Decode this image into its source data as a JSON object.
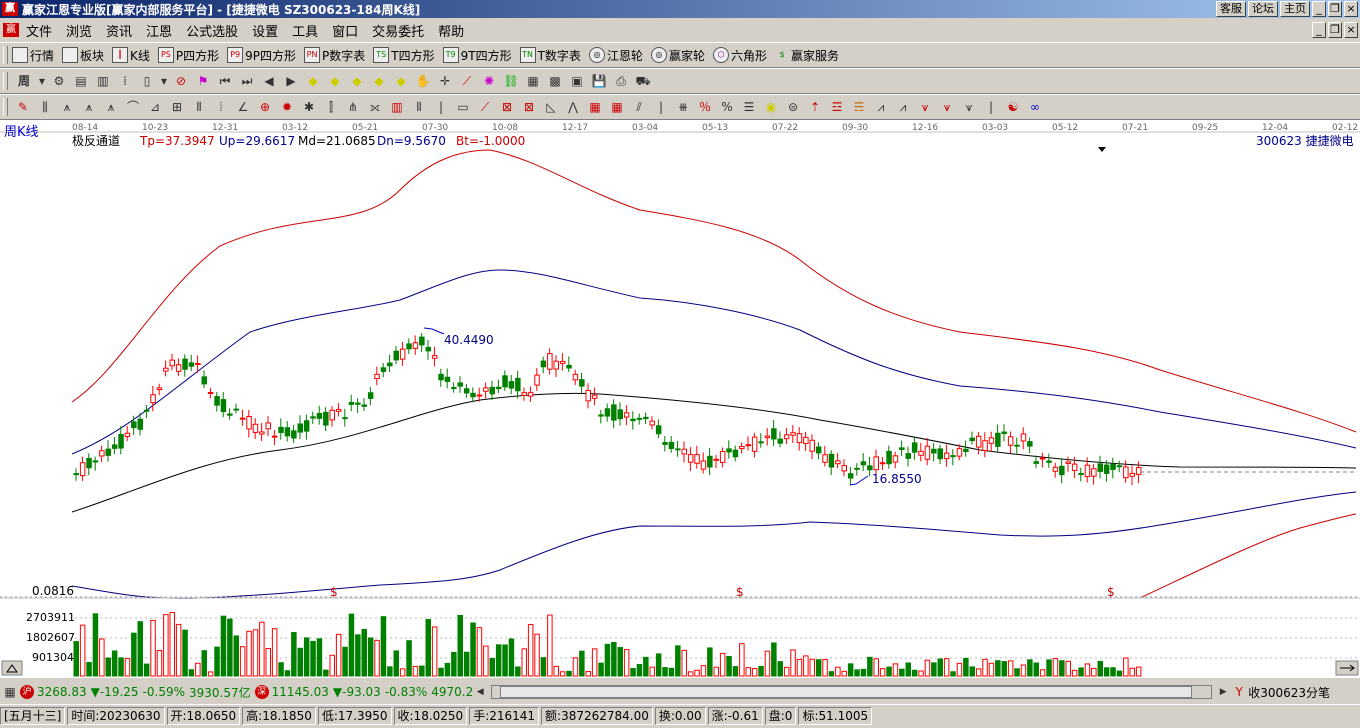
{
  "window": {
    "logo": "赢",
    "title": "赢家江恩专业版[赢家内部服务平台] - [捷捷微电   SZ300623-184周K线]",
    "buttons": [
      "客服",
      "论坛",
      "主页"
    ]
  },
  "menu": {
    "logo": "赢",
    "items": [
      "文件",
      "浏览",
      "资讯",
      "江恩",
      "公式选股",
      "设置",
      "工具",
      "窗口",
      "交易委托",
      "帮助"
    ]
  },
  "toolbar1": {
    "items": [
      {
        "label": "行情",
        "icon": "grid-icon",
        "mark": ""
      },
      {
        "label": "板块",
        "icon": "blocks-icon",
        "mark": ""
      },
      {
        "label": "K线",
        "icon": "candle-icon",
        "mark": ""
      },
      {
        "label": "P四方形",
        "icon": "square-icon",
        "mark": "PS"
      },
      {
        "label": "9P四方形",
        "icon": "square-icon",
        "mark": "P9"
      },
      {
        "label": "P数字表",
        "icon": "table-icon",
        "mark": "PN"
      },
      {
        "label": "T四方形",
        "icon": "square-icon",
        "mark": "TS"
      },
      {
        "label": "9T四方形",
        "icon": "square-icon",
        "mark": "T9"
      },
      {
        "label": "T数字表",
        "icon": "table-icon",
        "mark": "TN"
      },
      {
        "label": "江恩轮",
        "icon": "wheel-icon",
        "mark": ""
      },
      {
        "label": "赢家轮",
        "icon": "wheel-icon",
        "mark": ""
      },
      {
        "label": "六角形",
        "icon": "hexagon-icon",
        "mark": ""
      },
      {
        "label": "赢家服务",
        "icon": "dollar-icon",
        "mark": "$"
      }
    ]
  },
  "period": {
    "label": "周"
  },
  "chart": {
    "panel_title": "周K线",
    "indicator": {
      "name": "极反通道",
      "tp": "Tp=37.3947",
      "up": "Up=29.6617",
      "md": "Md=21.0685",
      "dn": "Dn=9.5670",
      "bt": "Bt=-1.0000"
    },
    "stock_label": "300623  捷捷微电",
    "date_axis": [
      "08-14",
      "10-23",
      "12-31",
      "03-12",
      "05-21",
      "07-30",
      "10-08",
      "12-17",
      "03-04",
      "05-13",
      "07-22",
      "09-30",
      "12-16",
      "03-03",
      "05-12",
      "07-21",
      "09-25",
      "12-04",
      "02-12"
    ],
    "high_label": "40.4490",
    "low_label": "16.8550",
    "lower_value": "0.0816",
    "markers": [
      "$",
      "$",
      "$"
    ],
    "volume_ticks": [
      "2703911",
      "1802607",
      "901304"
    ],
    "colors": {
      "up": "#ff0000",
      "down": "#008000",
      "top_channel": "#cc0000",
      "mid_channel": "#000080",
      "middle": "#000000"
    }
  },
  "index_bar": {
    "sh_icon": "沪",
    "sh_value": "3268.83",
    "sh_change": "▼-19.25",
    "sh_pct": "-0.59%",
    "sh_amount": "3930.57亿",
    "sz_icon": "深",
    "sz_value": "11145.03",
    "sz_change": "▼-93.03",
    "sz_pct": "-0.83%",
    "sz_amount": "4970.2",
    "right_text": "收300623分笔"
  },
  "status": {
    "day": "[五月十三]",
    "time": "时间:20230630",
    "open": "开:18.0650",
    "high": "高:18.1850",
    "low": "低:17.3950",
    "close": "收:18.0250",
    "hand": "手:216141",
    "amount": "额:387262784.00",
    "turnover": "换:0.00",
    "change": "涨:-0.61",
    "pan": "盘:0",
    "mark": "标:51.1005"
  }
}
